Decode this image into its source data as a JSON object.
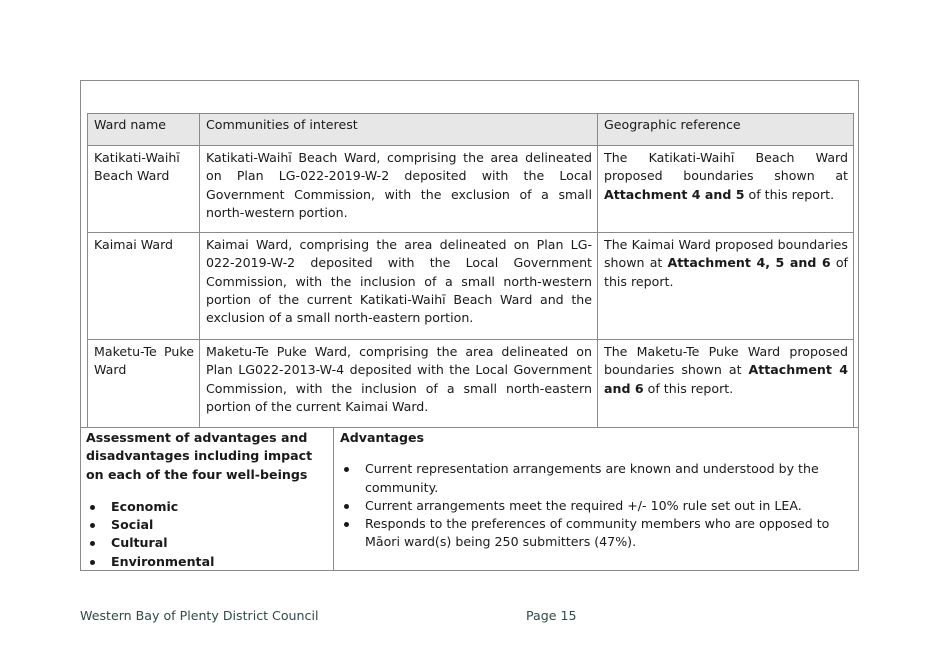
{
  "table": {
    "headers": [
      "Ward name",
      "Communities of interest",
      "Geographic reference"
    ],
    "rows": [
      {
        "ward": "Katikati-Waihī Beach Ward",
        "communities": "Katikati-Waihī Beach Ward, comprising the area delineated on Plan LG-022-2019-W-2 deposited with the Local Government Commission, with the exclusion of a small north-western portion.",
        "geo_pre": "The Katikati-Waihī Beach Ward proposed boundaries shown at ",
        "geo_bold": "Attachment 4 and 5",
        "geo_post": " of this report."
      },
      {
        "ward": "Kaimai Ward",
        "communities": "Kaimai Ward, comprising the area delineated on Plan LG-022-2019-W-2 deposited with the Local Government Commission, with the inclusion of a small north-western portion of the current Katikati-Waihī Beach Ward and the exclusion of a small north-eastern portion.",
        "geo_pre": "The Kaimai Ward proposed boundaries shown at ",
        "geo_bold": "Attachment 4, 5 and 6",
        "geo_post": " of this report."
      },
      {
        "ward": "Maketu-Te Puke Ward",
        "communities": "Maketu-Te Puke Ward, comprising the area delineated on Plan LG022-2013-W-4 deposited with the Local Government Commission, with the inclusion of a small north-eastern portion of the current Kaimai Ward.",
        "geo_pre": "The Maketu-Te Puke Ward proposed boundaries shown at ",
        "geo_bold": "Attachment 4 and 6",
        "geo_post": " of this report."
      }
    ]
  },
  "assessment": {
    "title": "Assessment of advantages and disadvantages including impact on each of the four well-beings",
    "wellbeings": [
      "Economic",
      "Social",
      "Cultural",
      "Environmental"
    ],
    "advantages_title": "Advantages",
    "advantages": [
      "Current representation arrangements are known and understood by the community.",
      "Current arrangements meet the required +/- 10% rule set out in LEA.",
      "Responds to the preferences of community members who are opposed to Māori ward(s) being 250 submitters (47%)."
    ]
  },
  "footer": {
    "org": "Western Bay of Plenty District Council",
    "page": "Page 15"
  }
}
